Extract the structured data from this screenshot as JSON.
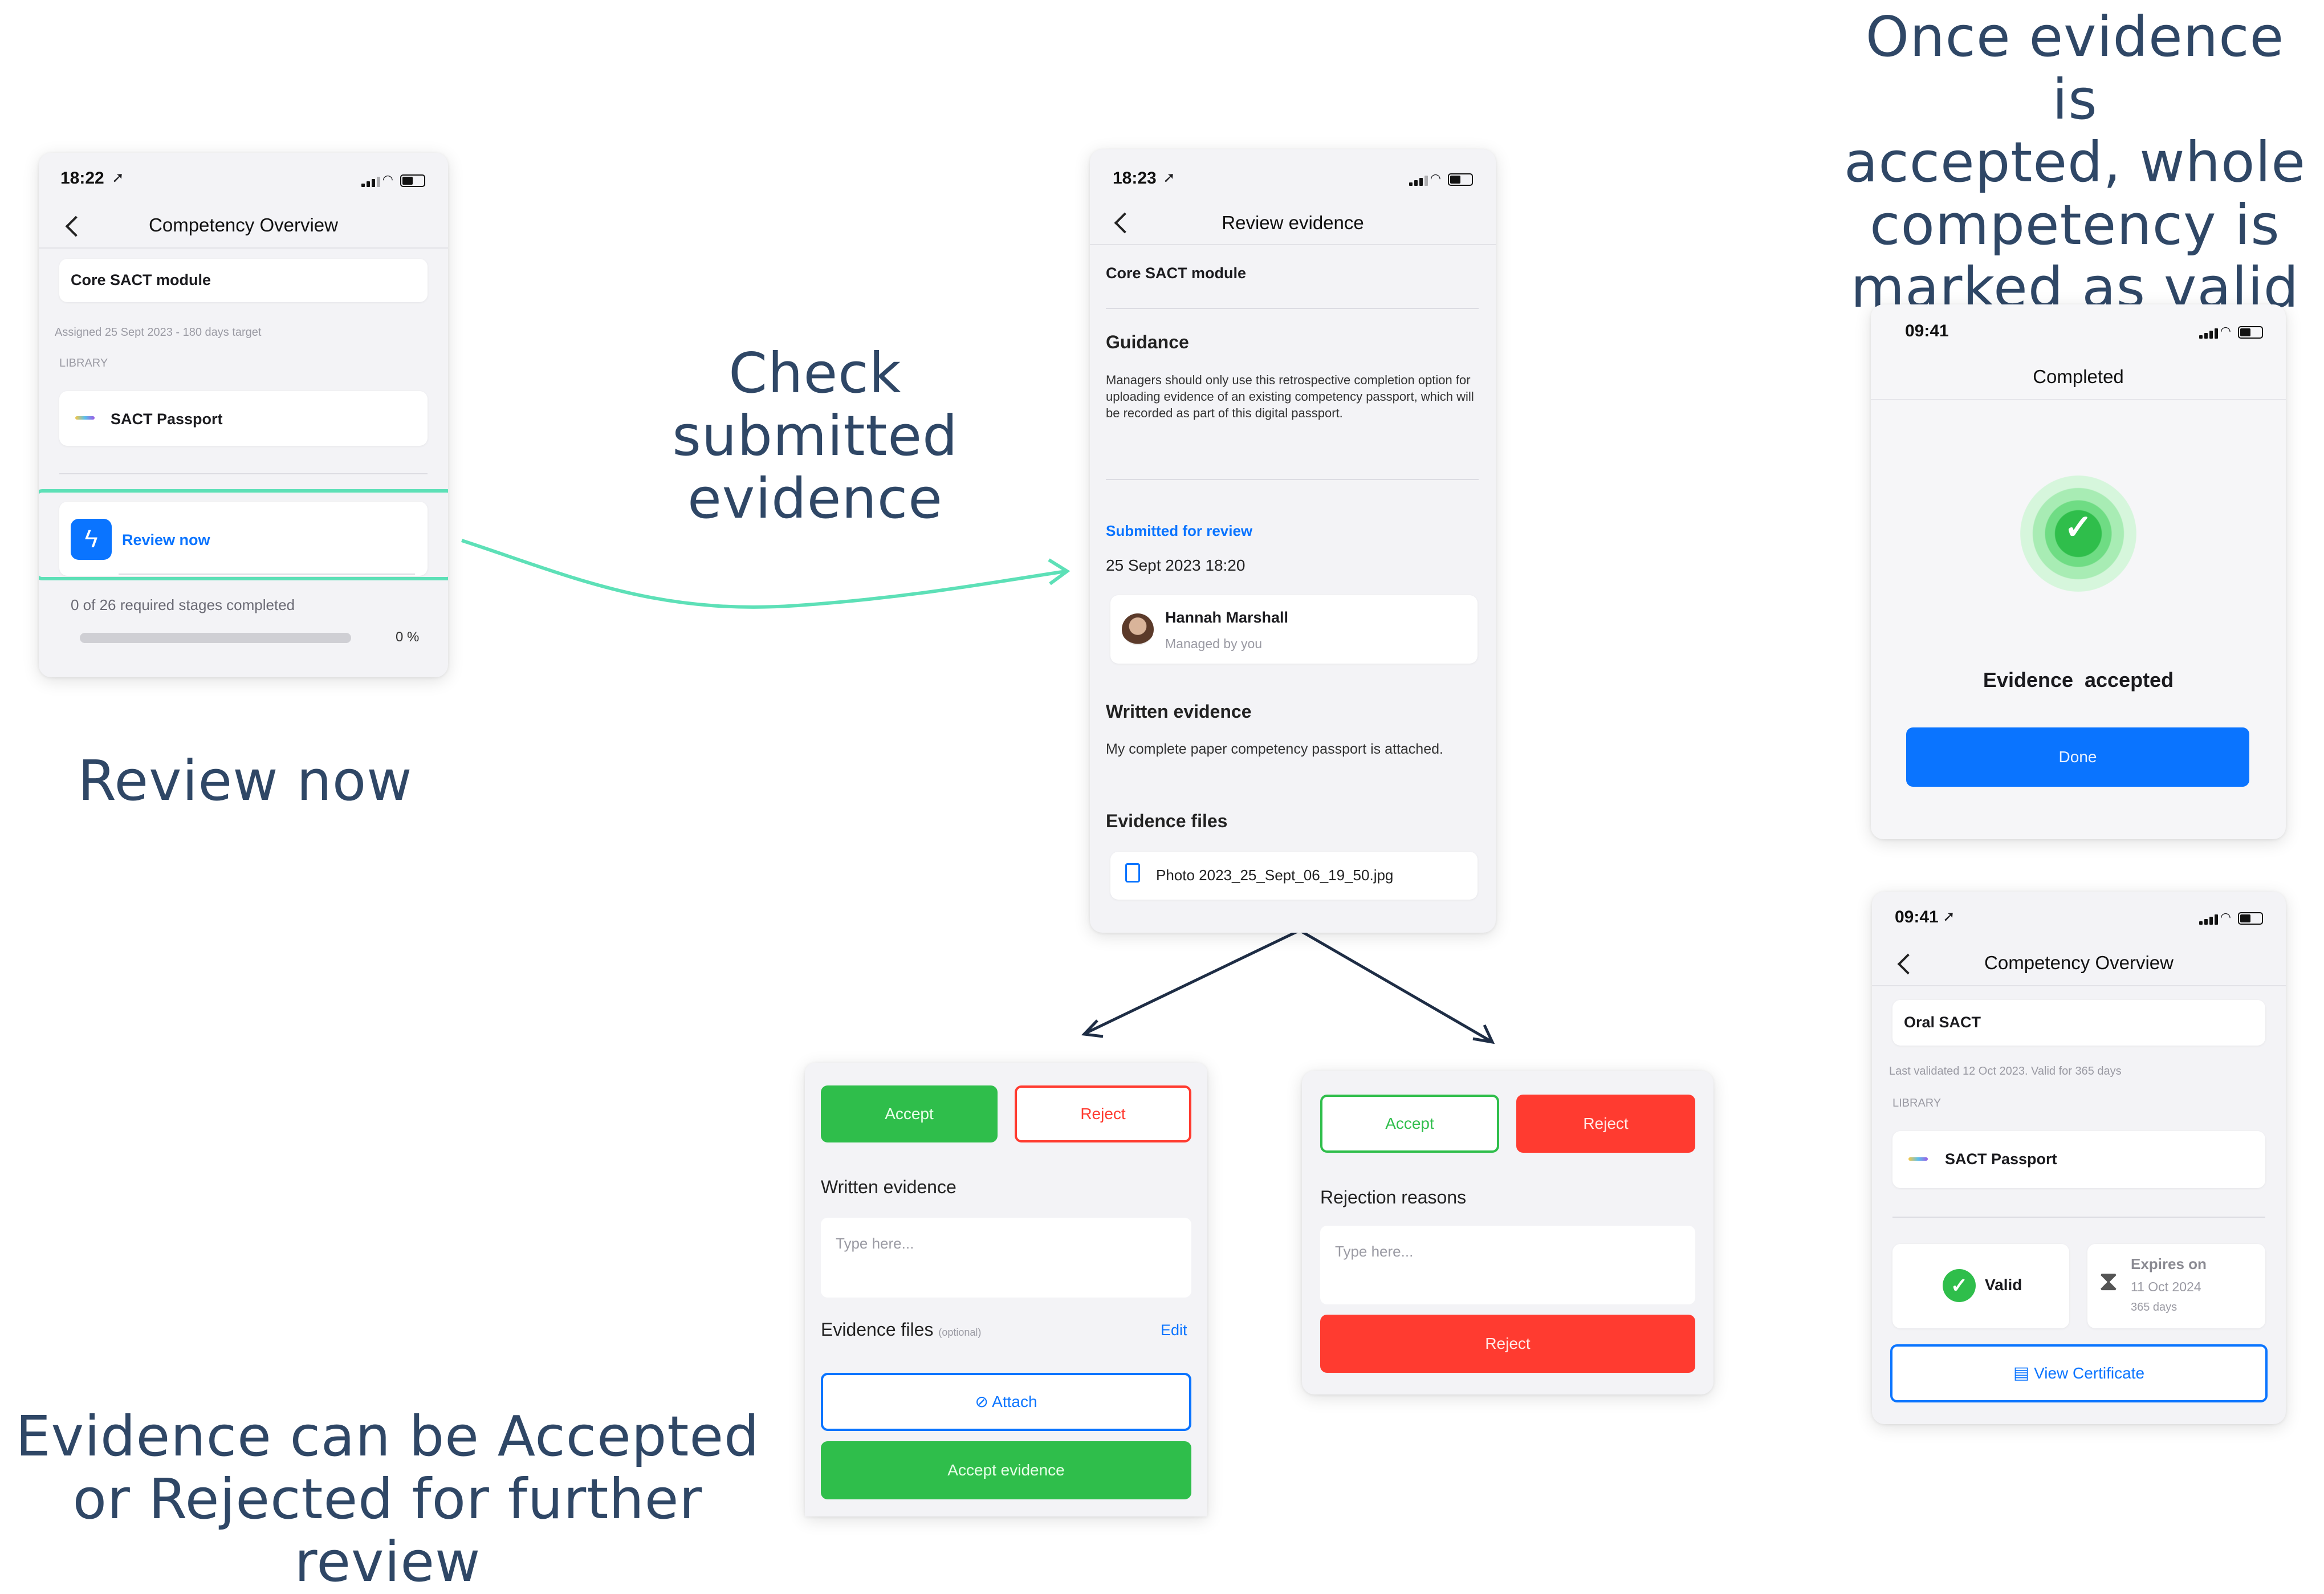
{
  "captions": {
    "review_now": "Review now",
    "check": "Check submitted\nevidence",
    "accepted": "Once evidence is\naccepted, whole\ncompetency is\nmarked as valid",
    "accept_reject": "Evidence can be Accepted\nor Rejected for further review"
  },
  "phone1": {
    "time": "18:22",
    "title": "Competency Overview",
    "module": "Core SACT module",
    "assigned": "Assigned 25 Sept 2023 - 180 days target",
    "library": "LIBRARY",
    "passport": "SACT Passport",
    "review_now": "Review now",
    "stages": "0 of 26 required stages completed",
    "progress_label": "0 %",
    "progress": 0
  },
  "phone2": {
    "time": "18:23",
    "title": "Review evidence",
    "module": "Core SACT module",
    "guidance_h": "Guidance",
    "guidance": "Managers should only use this retrospective completion option for uploading evidence of an existing competency passport, which will be recorded as part of this digital passport.",
    "submitted": "Submitted for review",
    "date": "25 Sept 2023 18:20",
    "person": "Hannah Marshall",
    "managed": "Managed by you",
    "written_h": "Written evidence",
    "written": "My complete paper competency passport is attached.",
    "files_h": "Evidence files",
    "file": "Photo 2023_25_Sept_06_19_50.jpg"
  },
  "accept_panel": {
    "accept": "Accept",
    "reject": "Reject",
    "written_h": "Written evidence",
    "placeholder": "Type here...",
    "files_h": "Evidence files",
    "optional": "(optional)",
    "edit": "Edit",
    "attach": "Attach",
    "accept_evidence": "Accept evidence"
  },
  "reject_panel": {
    "accept": "Accept",
    "reject": "Reject",
    "reasons_h": "Rejection reasons",
    "placeholder": "Type here...",
    "reject_btn": "Reject"
  },
  "completed": {
    "time": "09:41",
    "title": "Completed",
    "message": "Evidence  accepted",
    "done": "Done"
  },
  "phone4": {
    "time": "09:41",
    "title": "Competency Overview",
    "module": "Oral SACT",
    "validated": "Last validated 12 Oct 2023. Valid for 365 days",
    "library": "LIBRARY",
    "passport": "SACT Passport",
    "valid": "Valid",
    "expires": "Expires on",
    "expires_date": "11 Oct 2024",
    "days": "365 days",
    "view_cert": "View Certificate"
  },
  "colors": {
    "accent_blue": "#0a74ff",
    "accept_green": "#2fbe4b",
    "reject_red": "#ff3b30",
    "caption": "#2f4766",
    "highlight": "#5de0b7"
  }
}
